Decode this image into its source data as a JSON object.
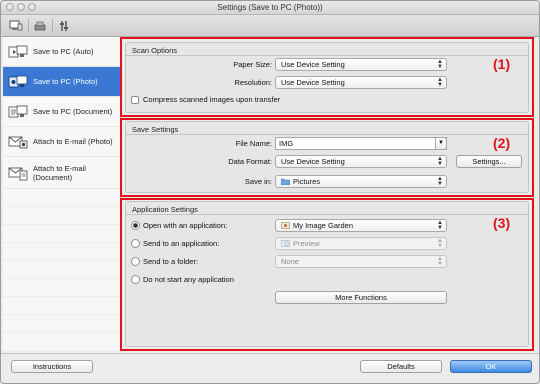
{
  "window": {
    "title": "Settings (Save to PC (Photo))"
  },
  "sidebar": {
    "items": [
      {
        "label": "Save to PC (Auto)",
        "icon": "save-to-pc-auto-icon",
        "selected": false
      },
      {
        "label": "Save to PC (Photo)",
        "icon": "save-to-pc-photo-icon",
        "selected": true
      },
      {
        "label": "Save to PC (Document)",
        "icon": "save-to-pc-document-icon",
        "selected": false
      },
      {
        "label": "Attach to E-mail (Photo)",
        "icon": "email-photo-icon",
        "selected": false
      },
      {
        "label": "Attach to E-mail (Document)",
        "icon": "email-document-icon",
        "selected": false
      }
    ]
  },
  "scan_options": {
    "title": "Scan Options",
    "badge": "(1)",
    "paper_size_label": "Paper Size:",
    "paper_size_value": "Use Device Setting",
    "resolution_label": "Resolution:",
    "resolution_value": "Use Device Setting",
    "compress_label": "Compress scanned images upon transfer",
    "compress_checked": false
  },
  "save_settings": {
    "title": "Save Settings",
    "badge": "(2)",
    "file_name_label": "File Name:",
    "file_name_value": "IMG",
    "data_format_label": "Data Format:",
    "data_format_value": "Use Device Setting",
    "settings_button": "Settings...",
    "save_in_label": "Save in:",
    "save_in_value": "Pictures"
  },
  "application_settings": {
    "title": "Application Settings",
    "badge": "(3)",
    "open_app_label": "Open with an application:",
    "open_app_value": "My Image Garden",
    "send_app_label": "Send to an application:",
    "send_app_value": "Preview",
    "send_folder_label": "Send to a folder:",
    "send_folder_value": "None",
    "no_app_label": "Do not start any application",
    "more_functions_button": "More Functions",
    "selected_option": "Open with an application:"
  },
  "footer": {
    "instructions_button": "Instructions",
    "defaults_button": "Defaults",
    "ok_button": "OK"
  },
  "colors": {
    "accent": "#3a78d4",
    "highlight": "#e0131b"
  }
}
